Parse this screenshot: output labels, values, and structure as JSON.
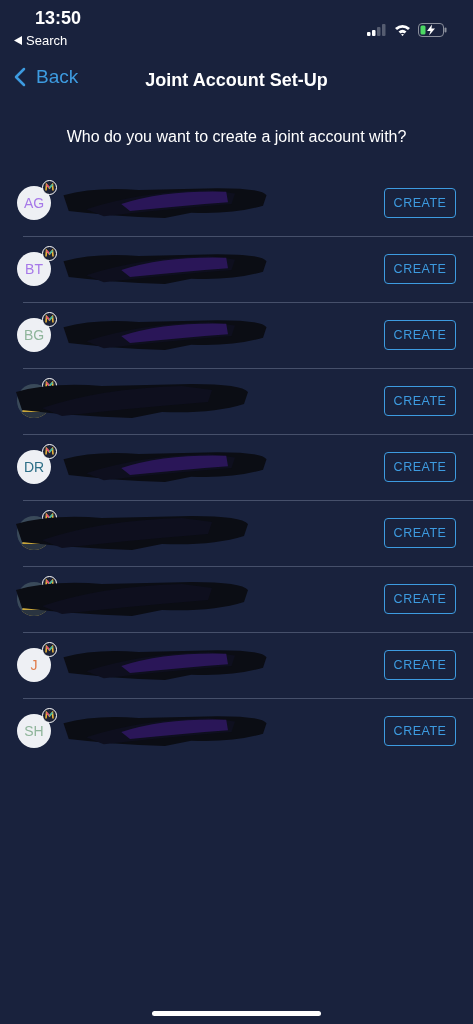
{
  "status_bar": {
    "time": "13:50",
    "back_app": "Search"
  },
  "nav": {
    "back": "Back",
    "title": "Joint Account Set-Up"
  },
  "prompt": "Who do you want to create a joint account with?",
  "contacts": [
    {
      "avatar": {
        "kind": "initials",
        "initials": "AG",
        "color": "#a678e8"
      },
      "name_redacted": true,
      "avatar_redacted": false,
      "action": "CREATE"
    },
    {
      "avatar": {
        "kind": "initials",
        "initials": "BT",
        "color": "#a678e8"
      },
      "name_redacted": true,
      "avatar_redacted": false,
      "action": "CREATE"
    },
    {
      "avatar": {
        "kind": "initials",
        "initials": "BG",
        "color": "#8fb59b"
      },
      "name_redacted": true,
      "avatar_redacted": false,
      "action": "CREATE"
    },
    {
      "name_redacted": true,
      "avatar_redacted": true,
      "action": "CREATE"
    },
    {
      "avatar": {
        "kind": "initials",
        "initials": "DR",
        "color": "#2c6e86"
      },
      "name_redacted": true,
      "avatar_redacted": false,
      "action": "CREATE"
    },
    {
      "name_redacted": true,
      "avatar_redacted": true,
      "action": "CREATE"
    },
    {
      "name_redacted": true,
      "avatar_redacted": true,
      "action": "CREATE"
    },
    {
      "avatar": {
        "kind": "initials",
        "initials": "J",
        "color": "#e07b4a"
      },
      "name_redacted": true,
      "avatar_redacted": false,
      "action": "CREATE"
    },
    {
      "avatar": {
        "kind": "initials",
        "initials": "SH",
        "color": "#8fb59b"
      },
      "name_redacted": true,
      "avatar_redacted": false,
      "action": "CREATE"
    }
  ]
}
